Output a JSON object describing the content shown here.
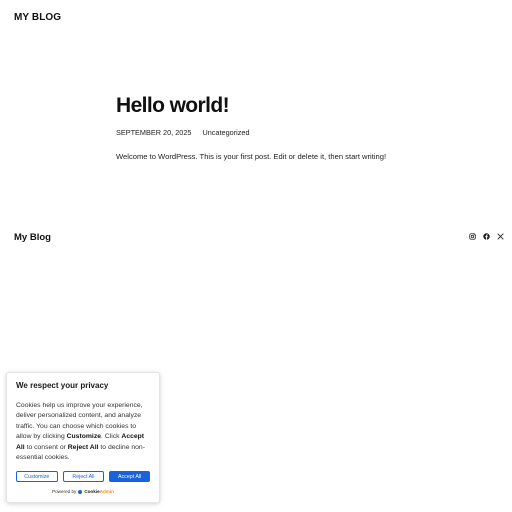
{
  "header": {
    "site_title": "MY BLOG"
  },
  "post": {
    "title": "Hello world!",
    "date": "SEPTEMBER 20, 2025",
    "category": "Uncategorized",
    "content": "Welcome to WordPress. This is your first post. Edit or delete it, then start writing!"
  },
  "footer": {
    "site_title": "My Blog",
    "social_icons": [
      "instagram-icon",
      "facebook-icon",
      "x-icon"
    ]
  },
  "cookie_banner": {
    "title": "We respect your privacy",
    "text_1": "Cookies help us improve your experience, deliver personalized content, and analyze traffic. You can choose which cookies to allow by clicking ",
    "bold_customize": "Customize",
    "text_2": ". Click ",
    "bold_accept": "Accept All",
    "text_3": " to consent or ",
    "bold_reject": "Reject All",
    "text_4": " to decline non-essential cookies.",
    "customize_label": "Customize",
    "reject_label": "Reject All",
    "accept_label": "Accept All",
    "powered_by": "Powered by",
    "brand_name_1": "Cookie",
    "brand_name_2": "Admin",
    "accent_color": "#1863dc"
  }
}
